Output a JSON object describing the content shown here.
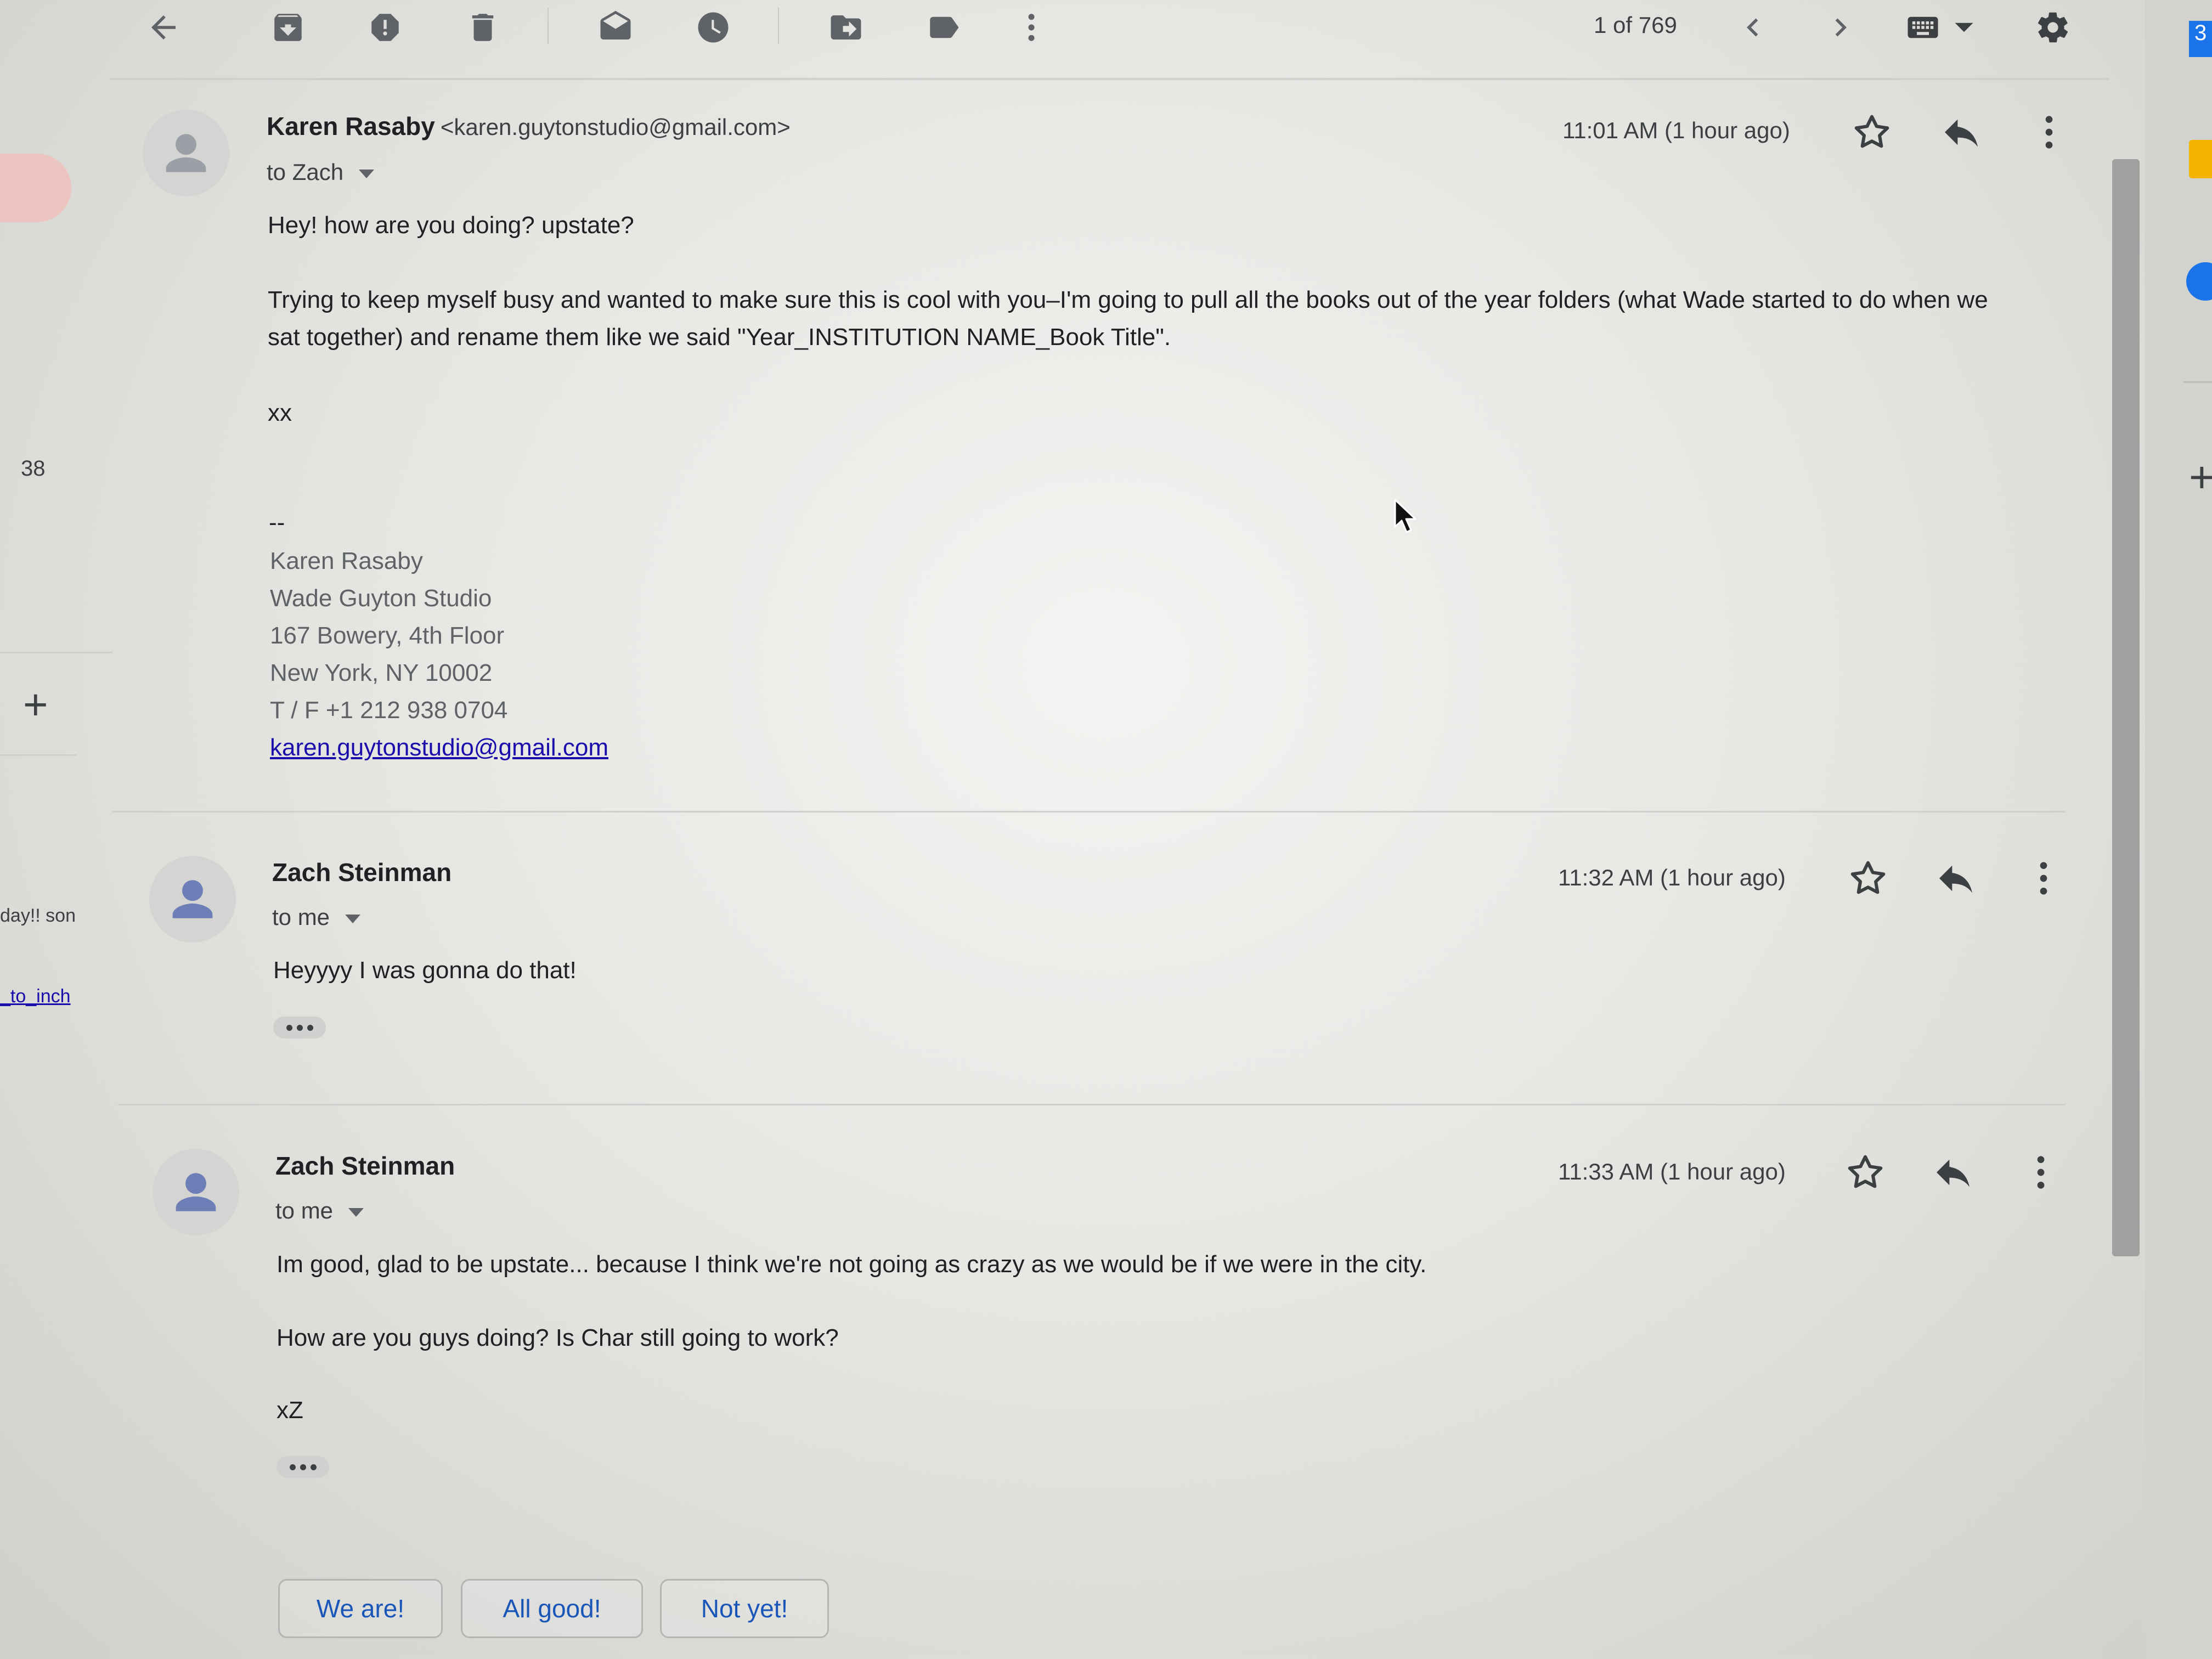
{
  "toolbar": {
    "icons": [
      "back-icon",
      "archive-icon",
      "report-spam-icon",
      "delete-icon",
      "mark-unread-icon",
      "snooze-icon",
      "move-to-icon",
      "label-icon",
      "more-vert-icon"
    ],
    "counter": "1 of 769",
    "icon_color": "#5f6368"
  },
  "left_rail": {
    "count": "38",
    "snippet": "day!!  son",
    "link": "_to_inch"
  },
  "right_rail": {
    "badge": "3"
  },
  "messages": [
    {
      "sender": "Karen Rasaby",
      "email": "<karen.guytonstudio@gmail.com>",
      "recipient": "to Zach",
      "time": "11:01 AM (1 hour ago)",
      "body": [
        "Hey! how are you doing? upstate?",
        "Trying to keep myself busy and wanted to make sure this is cool with you–I'm going to pull all the books out of the year folders (what Wade started to do when we",
        "sat together) and rename them like we said \"Year_INSTITUTION NAME_Book Title\".",
        "xx"
      ],
      "signature": {
        "dash": "--",
        "lines": [
          "Karen Rasaby",
          "Wade Guyton Studio",
          "167 Bowery, 4th Floor",
          "New York, NY 10002",
          "T / F  +1 212 938 0704"
        ],
        "link": "karen.guytonstudio@gmail.com"
      }
    },
    {
      "sender": "Zach Steinman",
      "recipient": "to me",
      "time": "11:32 AM (1 hour ago)",
      "body": [
        "Heyyyy I was gonna do that!"
      ]
    },
    {
      "sender": "Zach Steinman",
      "recipient": "to me",
      "time": "11:33 AM (1 hour ago)",
      "body": [
        "Im good, glad to be upstate... because I think we're not going as crazy as we would be if we were in the city.",
        "How are you guys doing? Is Char still going to work?",
        "xZ"
      ]
    }
  ],
  "smart_replies": [
    "We are!",
    "All good!",
    "Not yet!"
  ],
  "colors": {
    "link": "#1a0dab",
    "smart_reply_text": "#1a56b8",
    "keep_yellow": "#f4b400",
    "calendar_blue": "#1a73e8"
  }
}
